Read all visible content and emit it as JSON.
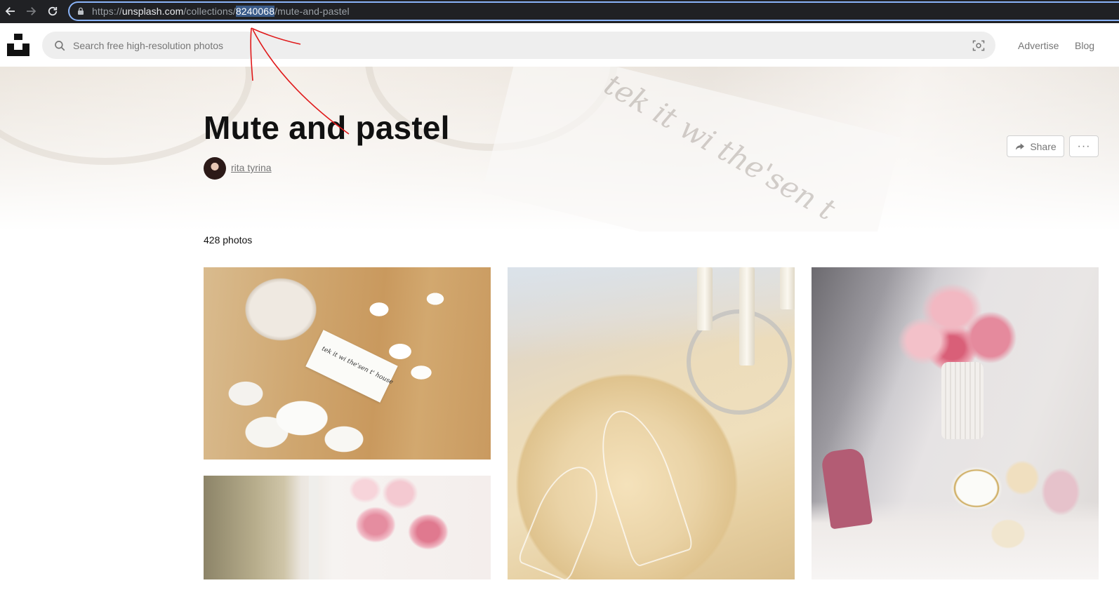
{
  "browser": {
    "url_scheme": "https://",
    "url_host": "unsplash.com",
    "url_path_before": "/collections/",
    "url_selected": "8240068",
    "url_path_after": "/mute-and-pastel",
    "icons": [
      "back-arrow-icon",
      "forward-arrow-icon",
      "reload-icon",
      "lock-icon"
    ]
  },
  "header": {
    "search_placeholder": "Search free high-resolution photos",
    "links": [
      "Advertise",
      "Blog"
    ],
    "icons": [
      "unsplash-logo",
      "search-icon",
      "visual-search-icon"
    ]
  },
  "collection": {
    "title": "Mute and pastel",
    "author": "rita tyrina",
    "share_label": "Share",
    "more_label": "···",
    "photo_count": "428 photos"
  },
  "photos": [
    {
      "name": "photo-candle-jar-petals",
      "tag_text": "tek it wi the'sen t' house"
    },
    {
      "name": "photo-candelabra-champagne-glasses"
    },
    {
      "name": "photo-pink-peonies-tea"
    },
    {
      "name": "photo-peonies-window"
    }
  ],
  "hero_script_text": "tek it wi the'sen t",
  "colors": {
    "chrome_bg": "#202124",
    "omnibox_focus": "#8ab4f8",
    "url_selection": "#3b5c8a",
    "search_bg": "#eeeeee",
    "title": "#111111",
    "muted": "#767676",
    "annotation": "#e0191a"
  }
}
